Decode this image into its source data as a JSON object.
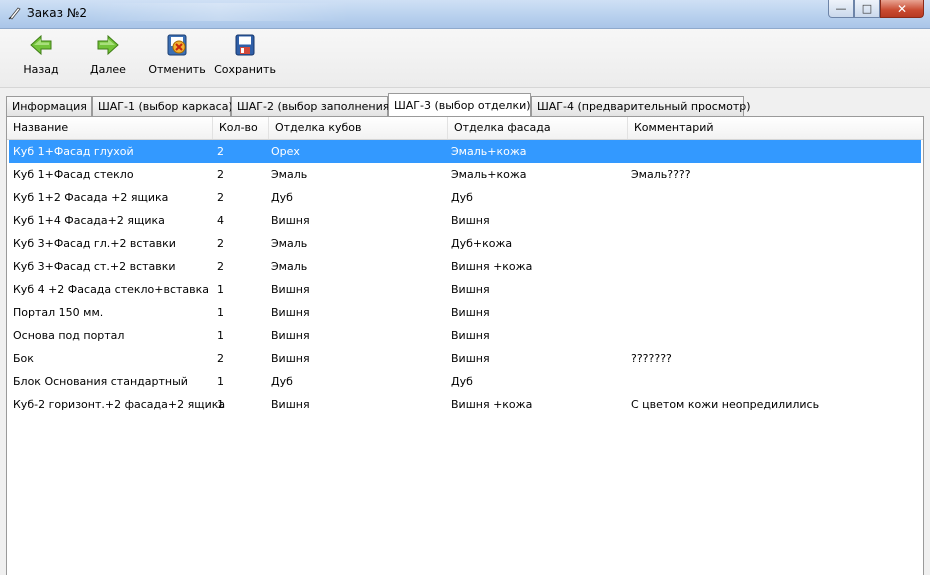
{
  "window": {
    "title": "Заказ №2"
  },
  "toolbar": {
    "back": "Назад",
    "next": "Далее",
    "cancel": "Отменить",
    "save": "Сохранить"
  },
  "tabs": [
    {
      "label": "Информация",
      "active": false
    },
    {
      "label": "ШАГ-1 (выбор каркаса)",
      "active": false
    },
    {
      "label": "ШАГ-2 (выбор заполнения)",
      "active": false
    },
    {
      "label": "ШАГ-3 (выбор отделки)",
      "active": true
    },
    {
      "label": "ШАГ-4 (предварительный просмотр)",
      "active": false
    }
  ],
  "grid": {
    "columns": [
      "Название",
      "Кол-во",
      "Отделка кубов",
      "Отделка фасада",
      "Комментарий"
    ],
    "rows": [
      [
        "Куб 1+Фасад глухой",
        "2",
        "Орех",
        "Эмаль+кожа",
        ""
      ],
      [
        "Куб 1+Фасад стекло",
        "2",
        "Эмаль",
        "Эмаль+кожа",
        "Эмаль????"
      ],
      [
        "Куб 1+2 Фасада +2 ящика",
        "2",
        "Дуб",
        "Дуб",
        ""
      ],
      [
        "Куб 1+4 Фасада+2 ящика",
        "4",
        "Вишня",
        "Вишня",
        ""
      ],
      [
        "Куб 3+Фасад гл.+2 вставки",
        "2",
        "Эмаль",
        "Дуб+кожа",
        ""
      ],
      [
        "Куб 3+Фасад ст.+2 вставки",
        "2",
        "Эмаль",
        "Вишня +кожа",
        ""
      ],
      [
        "Куб 4 +2 Фасада стекло+вставка",
        "1",
        "Вишня",
        "Вишня",
        ""
      ],
      [
        "Портал 150 мм.",
        "1",
        "Вишня",
        "Вишня",
        ""
      ],
      [
        "Основа под портал",
        "1",
        "Вишня",
        "Вишня",
        ""
      ],
      [
        "Бок",
        "2",
        "Вишня",
        "Вишня",
        "???????"
      ],
      [
        "Блок Основания стандартный",
        "1",
        "Дуб",
        "Дуб",
        ""
      ],
      [
        "Куб-2 горизонт.+2 фасада+2 ящика",
        "1",
        "Вишня",
        "Вишня +кожа",
        "С цветом кожи неопредилились"
      ]
    ],
    "selected_row": 0
  },
  "colors": {
    "selection": "#3399ff",
    "back_arrow": "#6cbf2a",
    "next_arrow": "#6cbf2a"
  }
}
